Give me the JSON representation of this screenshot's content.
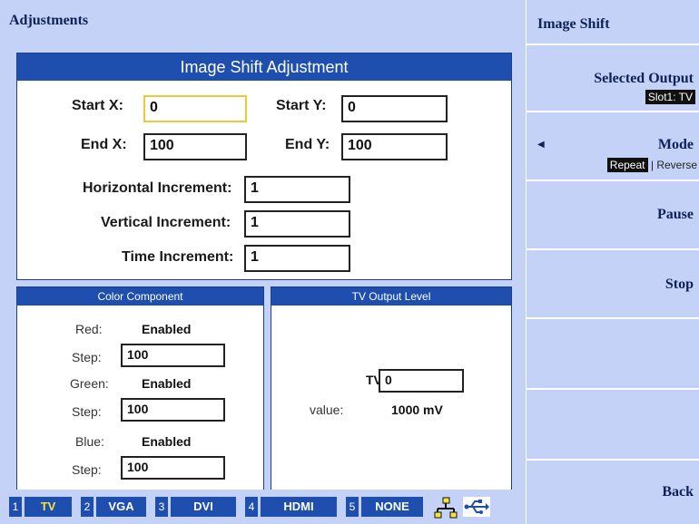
{
  "header": {
    "title": "Adjustments"
  },
  "right_panel": {
    "title": "Image Shift",
    "selected_output": {
      "label": "Selected Output",
      "value": "Slot1: TV"
    },
    "mode": {
      "label": "Mode",
      "options": [
        "Repeat",
        "Reverse"
      ],
      "selected": "Repeat",
      "separator": "|"
    },
    "pause_label": "Pause",
    "stop_label": "Stop",
    "back_label": "Back"
  },
  "image_shift": {
    "title": "Image Shift Adjustment",
    "start_x": {
      "label": "Start X:",
      "value": "0"
    },
    "start_y": {
      "label": "Start Y:",
      "value": "0"
    },
    "end_x": {
      "label": "End X:",
      "value": "100"
    },
    "end_y": {
      "label": "End Y:",
      "value": "100"
    },
    "horizontal_increment": {
      "label": "Horizontal Increment:",
      "value": "1"
    },
    "vertical_increment": {
      "label": "Vertical Increment:",
      "value": "1"
    },
    "time_increment": {
      "label": "Time Increment:",
      "value": "1"
    }
  },
  "color_component": {
    "title": "Color Component",
    "red": {
      "label": "Red:",
      "status": "Enabled",
      "step_label": "Step:",
      "step": "100"
    },
    "green": {
      "label": "Green:",
      "status": "Enabled",
      "step_label": "Step:",
      "step": "100"
    },
    "blue": {
      "label": "Blue:",
      "status": "Enabled",
      "step_label": "Step:",
      "step": "100"
    }
  },
  "tv_output": {
    "title": "TV Output Level",
    "tv_label": "TV",
    "tv_value": "0",
    "value_label": "value:",
    "value": "1000 mV"
  },
  "status_bar": {
    "slots": [
      {
        "num": "1",
        "name": "TV",
        "active": true
      },
      {
        "num": "2",
        "name": "VGA",
        "active": false
      },
      {
        "num": "3",
        "name": "DVI",
        "active": false
      },
      {
        "num": "4",
        "name": "HDMI",
        "active": false
      },
      {
        "num": "5",
        "name": "NONE",
        "active": false
      }
    ],
    "icons": [
      "network-icon",
      "usb-icon"
    ]
  },
  "colors": {
    "background": "#c3d2f6",
    "panel_header": "#1f4fae",
    "selected_field_border": "#f0c63a",
    "active_slot_text": "#f6e23a"
  }
}
